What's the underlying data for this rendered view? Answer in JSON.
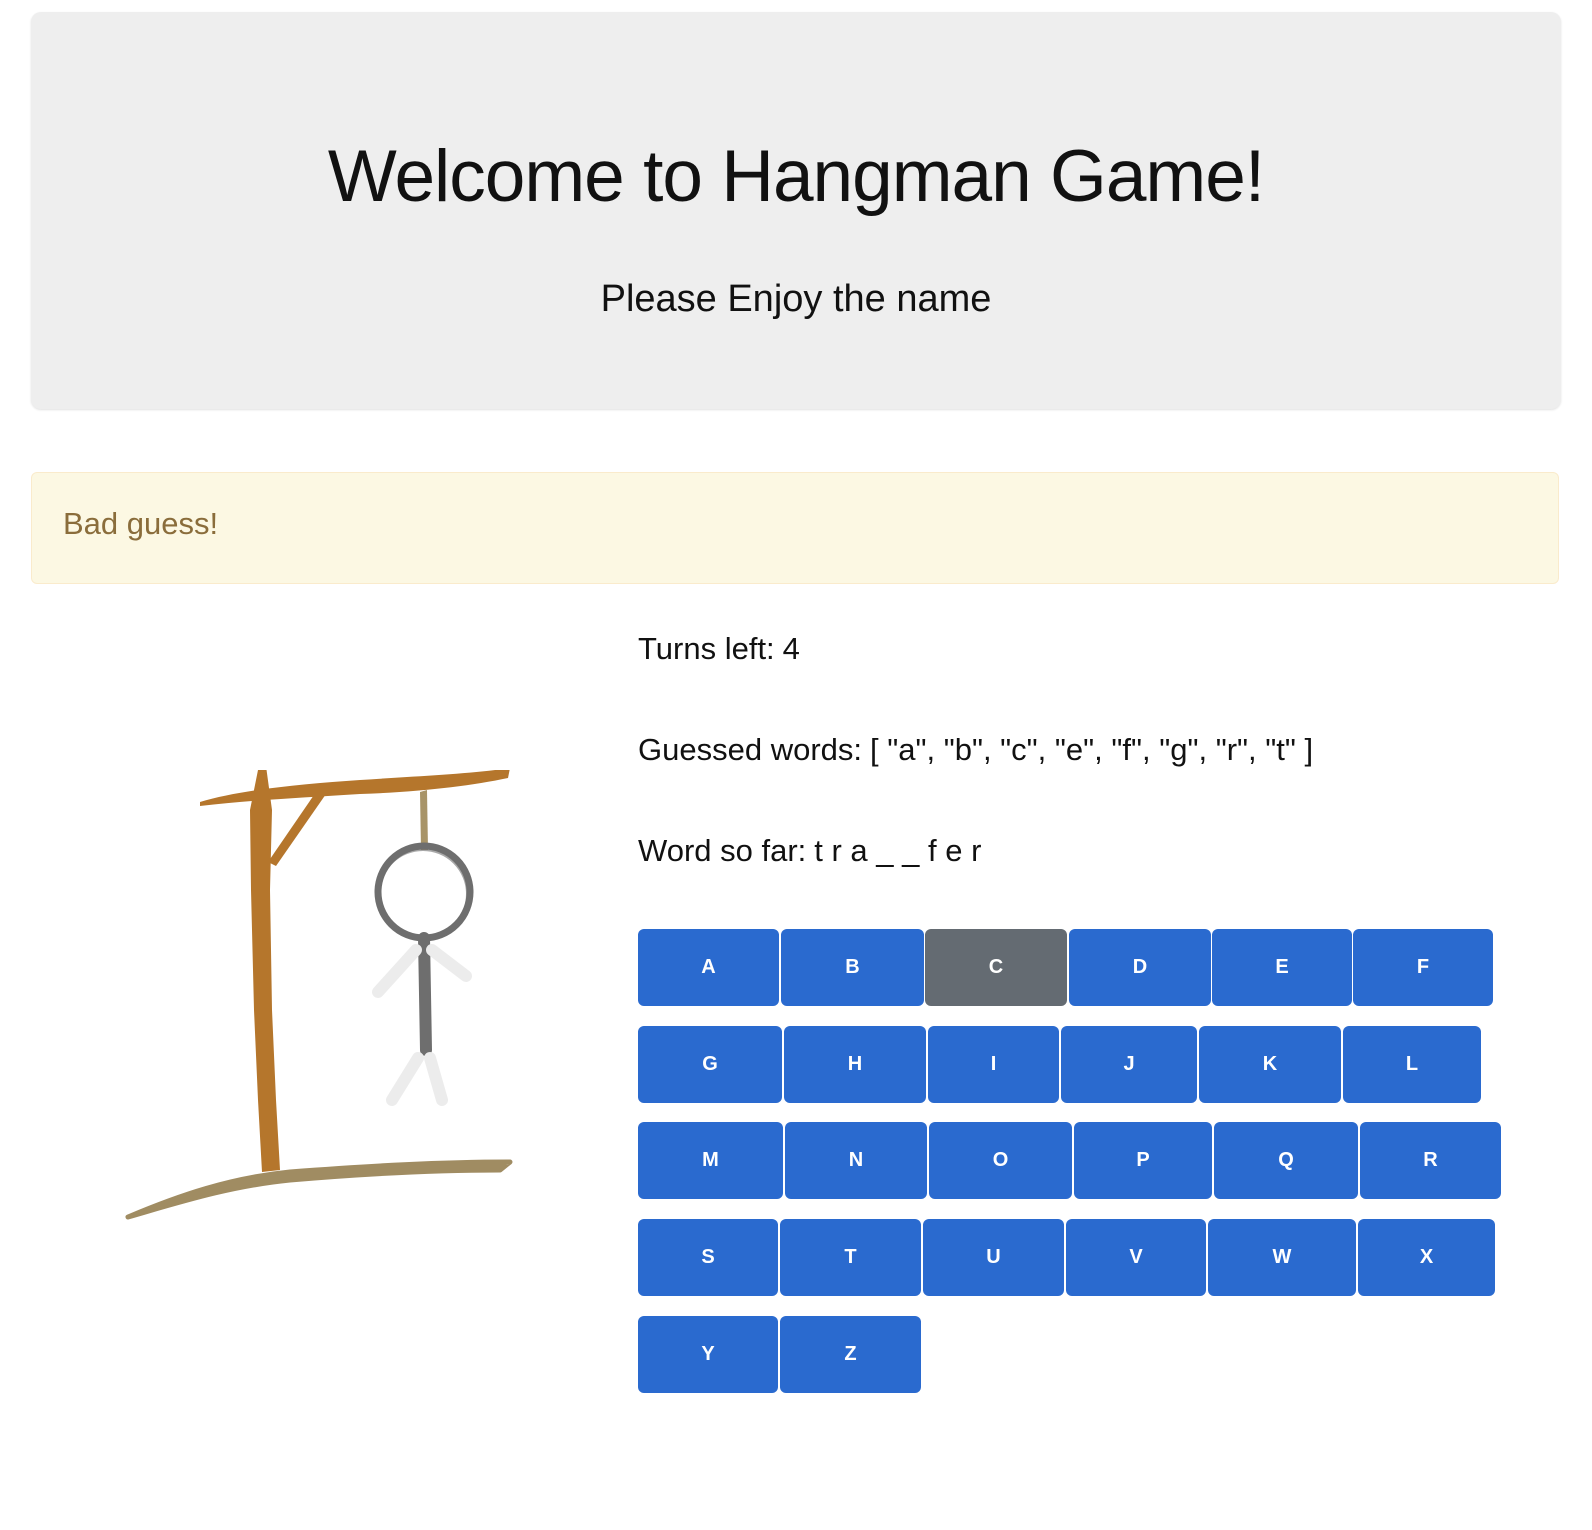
{
  "header": {
    "title": "Welcome to Hangman Game!",
    "subtitle": "Please Enjoy the name"
  },
  "alert": {
    "message": "Bad guess!"
  },
  "game": {
    "turns_label": "Turns left:",
    "turns_left": "4",
    "guessed_label": "Guessed words:",
    "guessed_value": "[ \"a\", \"b\", \"c\", \"e\", \"f\", \"g\", \"r\", \"t\" ]",
    "word_label": "Word so far:",
    "word_value": "t r a _ _ f e r"
  },
  "keyboard": {
    "keys": [
      "A",
      "B",
      "C",
      "D",
      "E",
      "F",
      "G",
      "H",
      "I",
      "J",
      "K",
      "L",
      "M",
      "N",
      "O",
      "P",
      "Q",
      "R",
      "S",
      "T",
      "U",
      "V",
      "W",
      "X",
      "Y",
      "Z"
    ],
    "disabled": [
      "C"
    ]
  },
  "colors": {
    "button_active": "#2a6acf",
    "button_disabled": "#646b72",
    "alert_bg": "#fcf8e3",
    "alert_text": "#8a6d3b",
    "jumbotron_bg": "#eeeeee",
    "gallows_post": "#b5762c",
    "ground": "#a08c62",
    "rope": "#a89468",
    "figure": "#6e6e6e",
    "figure_faint": "#ececec"
  },
  "drawing": {
    "icon": "hangman-gallows-icon"
  }
}
